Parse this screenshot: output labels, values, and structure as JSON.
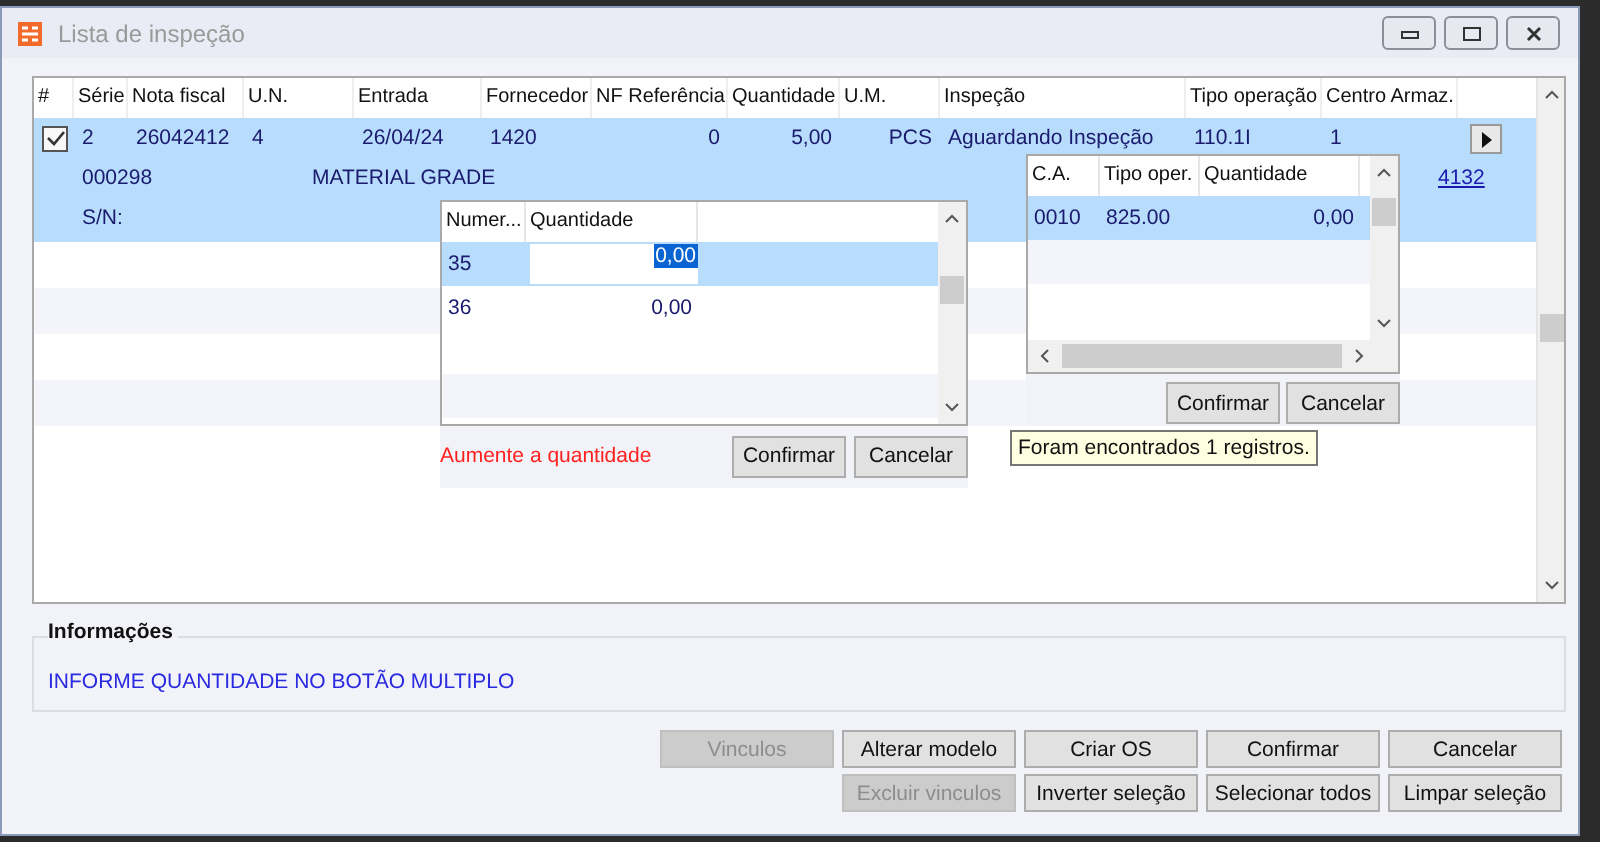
{
  "window": {
    "title": "Lista de inspeção"
  },
  "grid": {
    "check_header": "#",
    "columns": [
      "Série",
      "Nota fiscal",
      "U.N.",
      "Entrada",
      "Fornecedor",
      "NF Referência",
      "Quantidade",
      "U.M.",
      "Inspeção",
      "Tipo operação",
      "Centro Armaz."
    ],
    "rows": [
      {
        "selected": true,
        "checked": true,
        "cells": [
          "2",
          "26042412",
          "4",
          "26/04/24",
          "1420",
          "0",
          "5,00",
          "PCS",
          "Aguardando Inspeção",
          "110.1I",
          "1"
        ],
        "line2": [
          "000298",
          "MATERIAL GRADE"
        ],
        "link": "4132",
        "line3": "S/N:"
      }
    ]
  },
  "quantity_popup": {
    "columns": [
      "Numer...",
      "Quantidade"
    ],
    "rows": [
      {
        "number": "35",
        "quantity": "0,00",
        "selected": true
      },
      {
        "number": "36",
        "quantity": "0,00",
        "selected": false
      }
    ],
    "message": "Aumente a quantidade",
    "buttons": [
      "Confirmar",
      "Cancelar"
    ]
  },
  "storage_popup": {
    "columns": [
      "C.A.",
      "Tipo oper.",
      "Quantidade"
    ],
    "rows": [
      {
        "ca": "0010",
        "type": "825.00",
        "quantity": "0,00",
        "selected": true
      }
    ],
    "buttons": [
      "Confirmar",
      "Cancelar"
    ]
  },
  "tooltip": "Foram encontrados 1 registros.",
  "info": {
    "title": "Informações",
    "message": "INFORME QUANTIDADE NO BOTÃO MULTIPLO"
  },
  "buttons": [
    [
      {
        "label": "Vinculos",
        "disabled": true
      },
      {
        "label": "Alterar modelo",
        "disabled": false
      },
      {
        "label": "Criar OS",
        "disabled": false
      },
      {
        "label": "Confirmar",
        "disabled": false
      },
      {
        "label": "Cancelar",
        "disabled": false
      }
    ],
    [
      {
        "label": "Excluir vinculos",
        "disabled": true
      },
      {
        "label": "Inverter seleção",
        "disabled": false
      },
      {
        "label": "Selecionar todos",
        "disabled": false
      },
      {
        "label": "Limpar seleção",
        "disabled": false
      }
    ]
  ]
}
